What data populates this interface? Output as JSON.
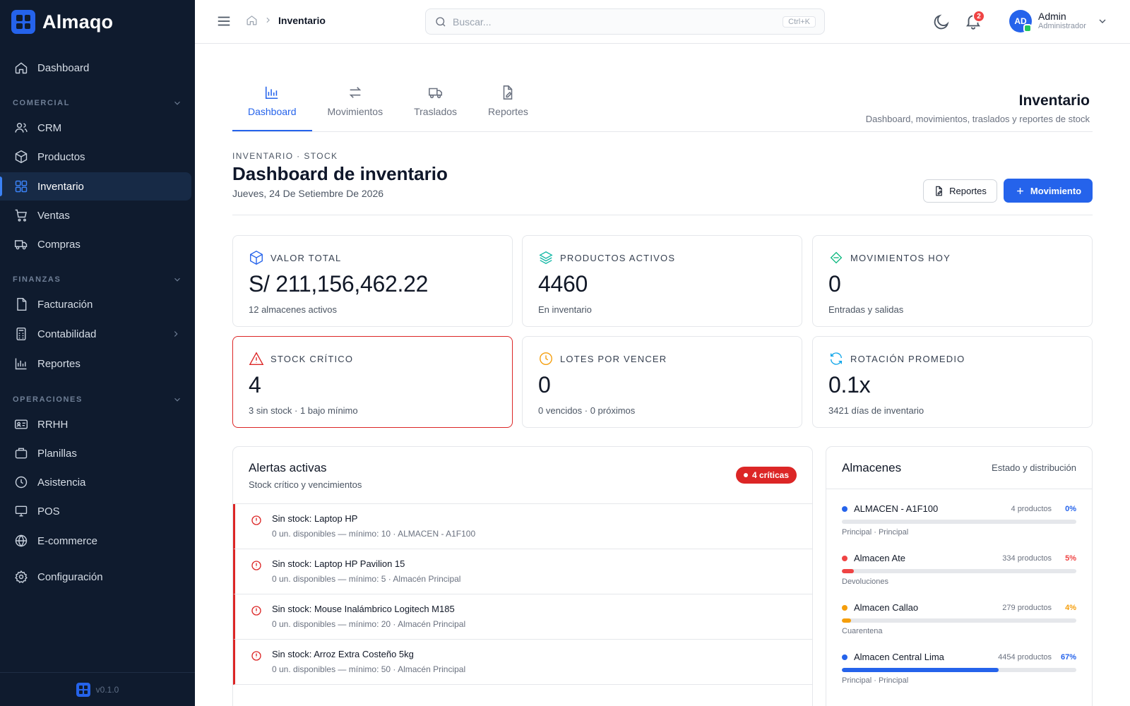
{
  "app": {
    "name": "Almaqo",
    "version": "v0.1.0"
  },
  "sidebar": {
    "top": {
      "label": "Dashboard"
    },
    "sections": [
      {
        "title": "COMERCIAL",
        "items": [
          "CRM",
          "Productos",
          "Inventario",
          "Ventas",
          "Compras"
        ]
      },
      {
        "title": "FINANZAS",
        "items": [
          "Facturación",
          "Contabilidad",
          "Reportes"
        ]
      },
      {
        "title": "OPERACIONES",
        "items": [
          "RRHH",
          "Planillas",
          "Asistencia",
          "POS",
          "E-commerce"
        ]
      }
    ],
    "settings": {
      "label": "Configuración"
    },
    "active": "Inventario"
  },
  "topbar": {
    "breadcrumb": "Inventario",
    "search": {
      "placeholder": "Buscar...",
      "shortcut": "Ctrl+K"
    },
    "notifications": "2",
    "user": {
      "initials": "AD",
      "name": "Admin",
      "role": "Administrador"
    }
  },
  "tabs": [
    {
      "label": "Dashboard",
      "icon": "bar-chart-icon",
      "active": true
    },
    {
      "label": "Movimientos",
      "icon": "arrows-exchange-icon"
    },
    {
      "label": "Traslados",
      "icon": "truck-icon"
    },
    {
      "label": "Reportes",
      "icon": "file-edit-icon"
    }
  ],
  "page": {
    "title": "Inventario",
    "subtitle": "Dashboard, movimientos, traslados y reportes de stock"
  },
  "dashboard": {
    "eyebrow": "INVENTARIO · STOCK",
    "title": "Dashboard de inventario",
    "date": "Jueves, 24 De Setiembre De 2026",
    "btn_reports": "Reportes",
    "btn_movement": "Movimiento"
  },
  "stats": [
    {
      "label": "VALOR TOTAL",
      "value": "S/ 211,156,462.22",
      "sub": "12 almacenes activos",
      "icon": "box-icon",
      "color": "#2563eb"
    },
    {
      "label": "PRODUCTOS ACTIVOS",
      "value": "4460",
      "sub": "En inventario",
      "icon": "layers-icon",
      "color": "#14b8a6"
    },
    {
      "label": "MOVIMIENTOS HOY",
      "value": "0",
      "sub": "Entradas y salidas",
      "icon": "diamond-icon",
      "color": "#10b981"
    },
    {
      "label": "STOCK CRÍTICO",
      "value": "4",
      "sub": "3 sin stock · 1 bajo mínimo",
      "icon": "warning-triangle-icon",
      "color": "#dc2626"
    },
    {
      "label": "LOTES POR VENCER",
      "value": "0",
      "sub": "0 vencidos · 0 próximos",
      "icon": "clock-icon",
      "color": "#f59e0b"
    },
    {
      "label": "ROTACIÓN PROMEDIO",
      "value": "0.1x",
      "sub": "3421 días de inventario",
      "icon": "refresh-icon",
      "color": "#0ea5e9"
    }
  ],
  "alerts": {
    "title": "Alertas activas",
    "subtitle": "Stock crítico y vencimientos",
    "badge": "4 críticas",
    "items": [
      {
        "title": "Sin stock: Laptop HP",
        "detail": "0 un. disponibles — mínimo: 10 · ALMACEN - A1F100"
      },
      {
        "title": "Sin stock: Laptop HP Pavilion 15",
        "detail": "0 un. disponibles — mínimo: 5 · Almacén Principal"
      },
      {
        "title": "Sin stock: Mouse Inalámbrico Logitech M185",
        "detail": "0 un. disponibles — mínimo: 20 · Almacén Principal"
      },
      {
        "title": "Sin stock: Arroz Extra Costeño 5kg",
        "detail": "0 un. disponibles — mínimo: 50 · Almacén Principal"
      }
    ]
  },
  "warehouses": {
    "title": "Almacenes",
    "subtitle": "Estado y distribución",
    "items": [
      {
        "name": "ALMACEN - A1F100",
        "count": "4 productos",
        "pct": "0%",
        "fill": 0.0,
        "note": "Principal · Principal",
        "color": "#2563eb"
      },
      {
        "name": "Almacen Ate",
        "count": "334 productos",
        "pct": "5%",
        "fill": 0.05,
        "note": "Devoluciones",
        "color": "#ef4444"
      },
      {
        "name": "Almacen Callao",
        "count": "279 productos",
        "pct": "4%",
        "fill": 0.04,
        "note": "Cuarentena",
        "color": "#f59e0b"
      },
      {
        "name": "Almacen Central Lima",
        "count": "4454 productos",
        "pct": "67%",
        "fill": 0.67,
        "note": "Principal · Principal",
        "color": "#2563eb"
      }
    ]
  }
}
